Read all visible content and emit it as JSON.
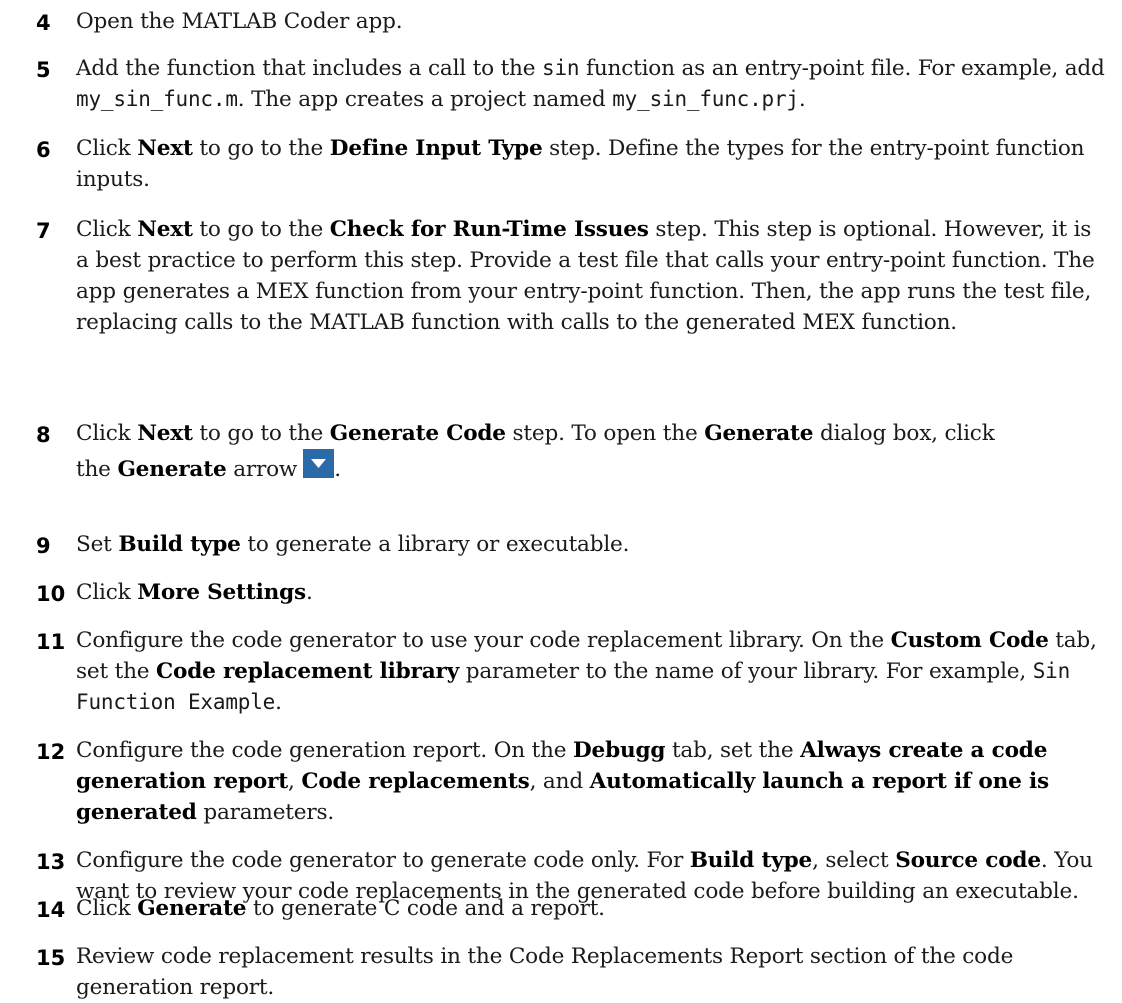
{
  "steps": [
    {
      "num": "4",
      "parts": [
        {
          "t": "Open the MATLAB Coder app."
        }
      ]
    },
    {
      "num": "5",
      "parts": [
        {
          "t": "Add the function that includes a call to the "
        },
        {
          "t": "sin",
          "s": "code"
        },
        {
          "t": " function as an entry-point file. For example, add "
        },
        {
          "t": "my_sin_func.m",
          "s": "code"
        },
        {
          "t": ". The app creates a project named "
        },
        {
          "t": "my_sin_func.prj",
          "s": "code"
        },
        {
          "t": "."
        }
      ]
    },
    {
      "num": "6",
      "parts": [
        {
          "t": "Click "
        },
        {
          "t": "Next",
          "s": "b"
        },
        {
          "t": " to go to the "
        },
        {
          "t": "Define Input Type",
          "s": "b"
        },
        {
          "t": " step. Define the types for the entry-point function inputs."
        }
      ]
    },
    {
      "num": "7",
      "parts": [
        {
          "t": "Click "
        },
        {
          "t": "Next",
          "s": "b"
        },
        {
          "t": " to go to the "
        },
        {
          "t": "Check for Run-Time Issues",
          "s": "b"
        },
        {
          "t": " step. This step is optional. However, it is a best practice to perform this step. Provide a test file that calls your entry-point function. The app generates a MEX function from your entry-point function. Then, the app runs the test file, replacing calls to the MATLAB function with calls to the generated MEX function."
        }
      ]
    },
    {
      "num": "8",
      "parts": [
        {
          "t": "Click "
        },
        {
          "t": "Next",
          "s": "b"
        },
        {
          "t": " to go to the "
        },
        {
          "t": "Generate Code",
          "s": "b"
        },
        {
          "t": " step. To open the "
        },
        {
          "t": "Generate",
          "s": "b"
        },
        {
          "t": " dialog box, click "
        },
        {
          "s": "gap"
        },
        {
          "t": "the "
        },
        {
          "t": "Generate",
          "s": "b"
        },
        {
          "t": " arrow"
        },
        {
          "s": "icon",
          "icon": "dropdown-arrow-icon"
        },
        {
          "t": "."
        }
      ]
    },
    {
      "num": "9",
      "parts": [
        {
          "t": "Set "
        },
        {
          "t": "Build type",
          "s": "b"
        },
        {
          "t": " to generate a library or executable."
        }
      ]
    },
    {
      "num": "10",
      "parts": [
        {
          "t": "Click "
        },
        {
          "t": "More Settings",
          "s": "b"
        },
        {
          "t": "."
        }
      ]
    },
    {
      "num": "11",
      "parts": [
        {
          "t": "Configure the code generator to use your code replacement library. On the "
        },
        {
          "t": "Custom Code",
          "s": "b"
        },
        {
          "t": " tab, set the "
        },
        {
          "t": "Code replacement library",
          "s": "b"
        },
        {
          "t": " parameter to the name of your library. For example, "
        },
        {
          "t": "Sin Function Example",
          "s": "code"
        },
        {
          "t": "."
        }
      ]
    },
    {
      "num": "12",
      "parts": [
        {
          "t": "Configure the code generation report. On the "
        },
        {
          "t": "Debugg",
          "s": "b"
        },
        {
          "t": " tab, set the "
        },
        {
          "t": "Always create a code generation report",
          "s": "b"
        },
        {
          "t": ", "
        },
        {
          "t": "Code replacements",
          "s": "b"
        },
        {
          "t": ", and "
        },
        {
          "t": "Automatically launch a report if one is generated",
          "s": "b"
        },
        {
          "t": " parameters."
        }
      ]
    },
    {
      "num": "13",
      "parts": [
        {
          "t": "Configure the code generator to generate code only. For "
        },
        {
          "t": "Build type",
          "s": "b"
        },
        {
          "t": ", select "
        },
        {
          "t": "Source code",
          "s": "b"
        },
        {
          "t": ". You want to review your code replacements in the generated code before building an executable."
        }
      ]
    },
    {
      "num": "14",
      "parts": [
        {
          "t": "Click "
        },
        {
          "t": "Generate",
          "s": "b"
        },
        {
          "t": " to generate C code and a report."
        }
      ]
    },
    {
      "num": "15",
      "parts": [
        {
          "t": "Review code replacement results in the Code Replacements Report section of the code generation report."
        }
      ]
    }
  ]
}
